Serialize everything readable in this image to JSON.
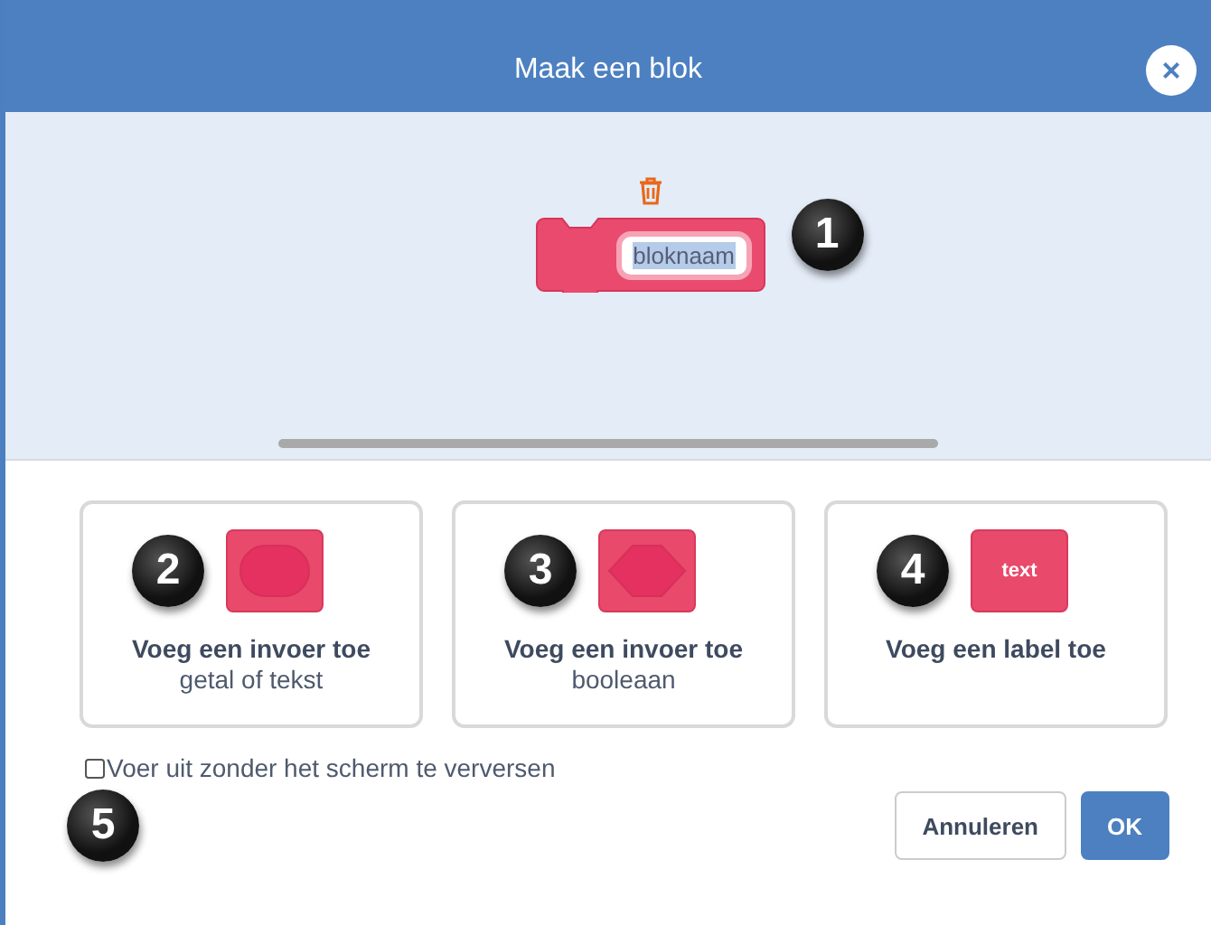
{
  "window": {
    "title": "Maak een blok",
    "close": "×"
  },
  "block": {
    "name": "bloknaam",
    "name_highlighted": true,
    "callout": "1"
  },
  "options": [
    {
      "kind": "round",
      "callout": "2",
      "title": "Voeg een invoer toe",
      "subtitle": "getal of tekst"
    },
    {
      "kind": "boolean",
      "callout": "3",
      "title": "Voeg een invoer toe",
      "subtitle": "booleaan"
    },
    {
      "kind": "label",
      "callout": "4",
      "sample": "text",
      "title": "Voeg een label toe"
    }
  ],
  "checkbox": {
    "label": "Voer uit zonder het scherm te verversen",
    "checked": false,
    "callout": "5"
  },
  "buttons": [
    {
      "label": "Annuleren",
      "kind": "secondary"
    },
    {
      "label": "OK",
      "kind": "primary"
    }
  ]
}
